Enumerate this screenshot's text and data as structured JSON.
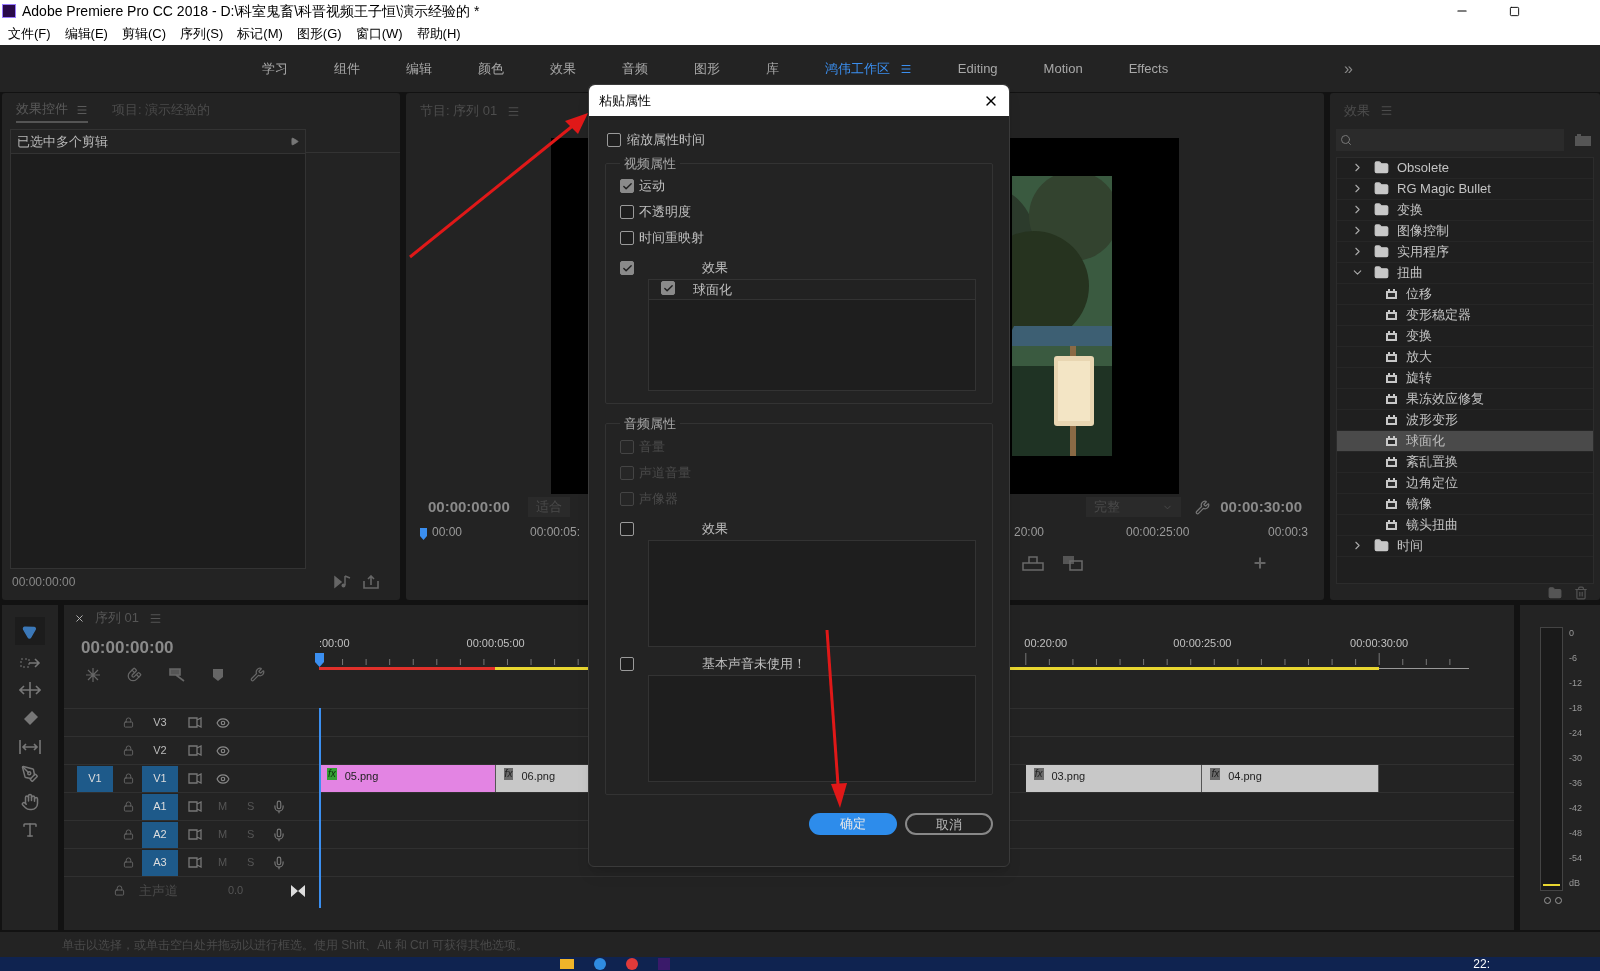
{
  "window": {
    "title": "Adobe Premiere Pro CC 2018 - D:\\科室鬼畜\\科晋视频王子恒\\演示经验的 *"
  },
  "menu": [
    "文件(F)",
    "编辑(E)",
    "剪辑(C)",
    "序列(S)",
    "标记(M)",
    "图形(G)",
    "窗口(W)",
    "帮助(H)"
  ],
  "workspaces": [
    {
      "label": "学习",
      "selected": false
    },
    {
      "label": "组件",
      "selected": false
    },
    {
      "label": "编辑",
      "selected": false
    },
    {
      "label": "颜色",
      "selected": false
    },
    {
      "label": "效果",
      "selected": false
    },
    {
      "label": "音频",
      "selected": false
    },
    {
      "label": "图形",
      "selected": false
    },
    {
      "label": "库",
      "selected": false
    },
    {
      "label": "鸿伟工作区",
      "selected": true
    },
    {
      "label": "Editing",
      "selected": false
    },
    {
      "label": "Motion",
      "selected": false
    },
    {
      "label": "Effects",
      "selected": false
    }
  ],
  "workspace_overflow": "»",
  "source_panel": {
    "tabs": [
      {
        "label": "效果控件",
        "selected": true
      },
      {
        "label": "项目: 演示经验的",
        "selected": false
      }
    ],
    "clip_header": "已选中多个剪辑",
    "timecode": "00:00:00:00"
  },
  "program_monitor": {
    "title": "节目: 序列 01",
    "timecode": "00:00:00:00",
    "zoom": "适合",
    "quality": "完整",
    "duration": "00:00:30:00",
    "ruler": [
      {
        "label": "00:00"
      },
      {
        "label": "00:00:05:"
      },
      {
        "label": "20:00"
      },
      {
        "label": "00:00:25:00"
      },
      {
        "label": "00:00:3"
      }
    ]
  },
  "effects_panel": {
    "title": "效果",
    "tree": [
      {
        "label": "Obsolete",
        "expanded": false
      },
      {
        "label": "RG Magic Bullet",
        "expanded": false
      },
      {
        "label": "变换",
        "expanded": false
      },
      {
        "label": "图像控制",
        "expanded": false
      },
      {
        "label": "实用程序",
        "expanded": false
      },
      {
        "label": "扭曲",
        "expanded": true,
        "children": [
          {
            "label": "位移",
            "selected": false
          },
          {
            "label": "变形稳定器",
            "selected": false
          },
          {
            "label": "变换",
            "selected": false
          },
          {
            "label": "放大",
            "selected": false
          },
          {
            "label": "旋转",
            "selected": false
          },
          {
            "label": "果冻效应修复",
            "selected": false
          },
          {
            "label": "波形变形",
            "selected": false
          },
          {
            "label": "球面化",
            "selected": true
          },
          {
            "label": "紊乱置换",
            "selected": false
          },
          {
            "label": "边角定位",
            "selected": false
          },
          {
            "label": "镜像",
            "selected": false
          },
          {
            "label": "镜头扭曲",
            "selected": false
          }
        ]
      },
      {
        "label": "时间",
        "expanded": false
      }
    ]
  },
  "timeline": {
    "title": "序列 01",
    "timecode": "00:00:00:00",
    "ruler": [
      {
        "label": ":00:00"
      },
      {
        "label": "00:00:05:00"
      },
      {
        "label": "00:20:00"
      },
      {
        "label": "00:00:25:00"
      },
      {
        "label": "00:00:30:00"
      }
    ],
    "tracks": [
      {
        "kind": "video",
        "name": "V3"
      },
      {
        "kind": "video",
        "name": "V2"
      },
      {
        "kind": "video",
        "name": "V1",
        "source": "V1",
        "clips": [
          {
            "label": "05.png",
            "color": "#e384e3",
            "badge": "fx",
            "fx_active": true
          },
          {
            "label": "06.png",
            "color": "#c8c8c8",
            "badge": "fx",
            "fx_active": false
          },
          {
            "label": "03.png",
            "color": "#c8c8c8",
            "badge": "fx",
            "fx_active": false
          },
          {
            "label": "04.png",
            "color": "#c8c8c8",
            "badge": "fx",
            "fx_active": false
          }
        ]
      },
      {
        "kind": "audio",
        "name": "A1",
        "mute": "M",
        "solo": "S"
      },
      {
        "kind": "audio",
        "name": "A2",
        "mute": "M",
        "solo": "S"
      },
      {
        "kind": "audio",
        "name": "A3",
        "mute": "M",
        "solo": "S"
      },
      {
        "kind": "master",
        "name": "主声道",
        "value": "0.0"
      }
    ]
  },
  "meter": {
    "scale": [
      "0",
      "-6",
      "-12",
      "-18",
      "-24",
      "-30",
      "-36",
      "-42",
      "-48",
      "-54",
      "dB"
    ]
  },
  "status_bar": "单击以选择，或单击空白处并拖动以进行框选。使用 Shift、Alt 和 Ctrl 可获得其他选项。",
  "taskbar": {
    "clock": "22:"
  },
  "dialog": {
    "title": "粘贴属性",
    "scale_time": {
      "label": "缩放属性时间",
      "checked": false
    },
    "groups": [
      {
        "title": "视频属性",
        "items": [
          {
            "label": "运动",
            "checked": true,
            "disabled": false
          },
          {
            "label": "不透明度",
            "checked": false,
            "disabled": false
          },
          {
            "label": "时间重映射",
            "checked": false,
            "disabled": false
          }
        ],
        "sections": [
          {
            "label": "效果",
            "checked": true,
            "entries": [
              {
                "label": "球面化",
                "checked": true
              }
            ]
          }
        ]
      },
      {
        "title": "音频属性",
        "items": [
          {
            "label": "音量",
            "checked": false,
            "disabled": true
          },
          {
            "label": "声道音量",
            "checked": false,
            "disabled": true
          },
          {
            "label": "声像器",
            "checked": false,
            "disabled": true
          }
        ],
        "sections": [
          {
            "label": "效果",
            "checked": false
          },
          {
            "label": "基本声音未使用！",
            "checked": false
          }
        ]
      }
    ],
    "buttons": [
      {
        "label": "确定",
        "kind": "primary"
      },
      {
        "label": "取消",
        "kind": "secondary"
      }
    ]
  }
}
